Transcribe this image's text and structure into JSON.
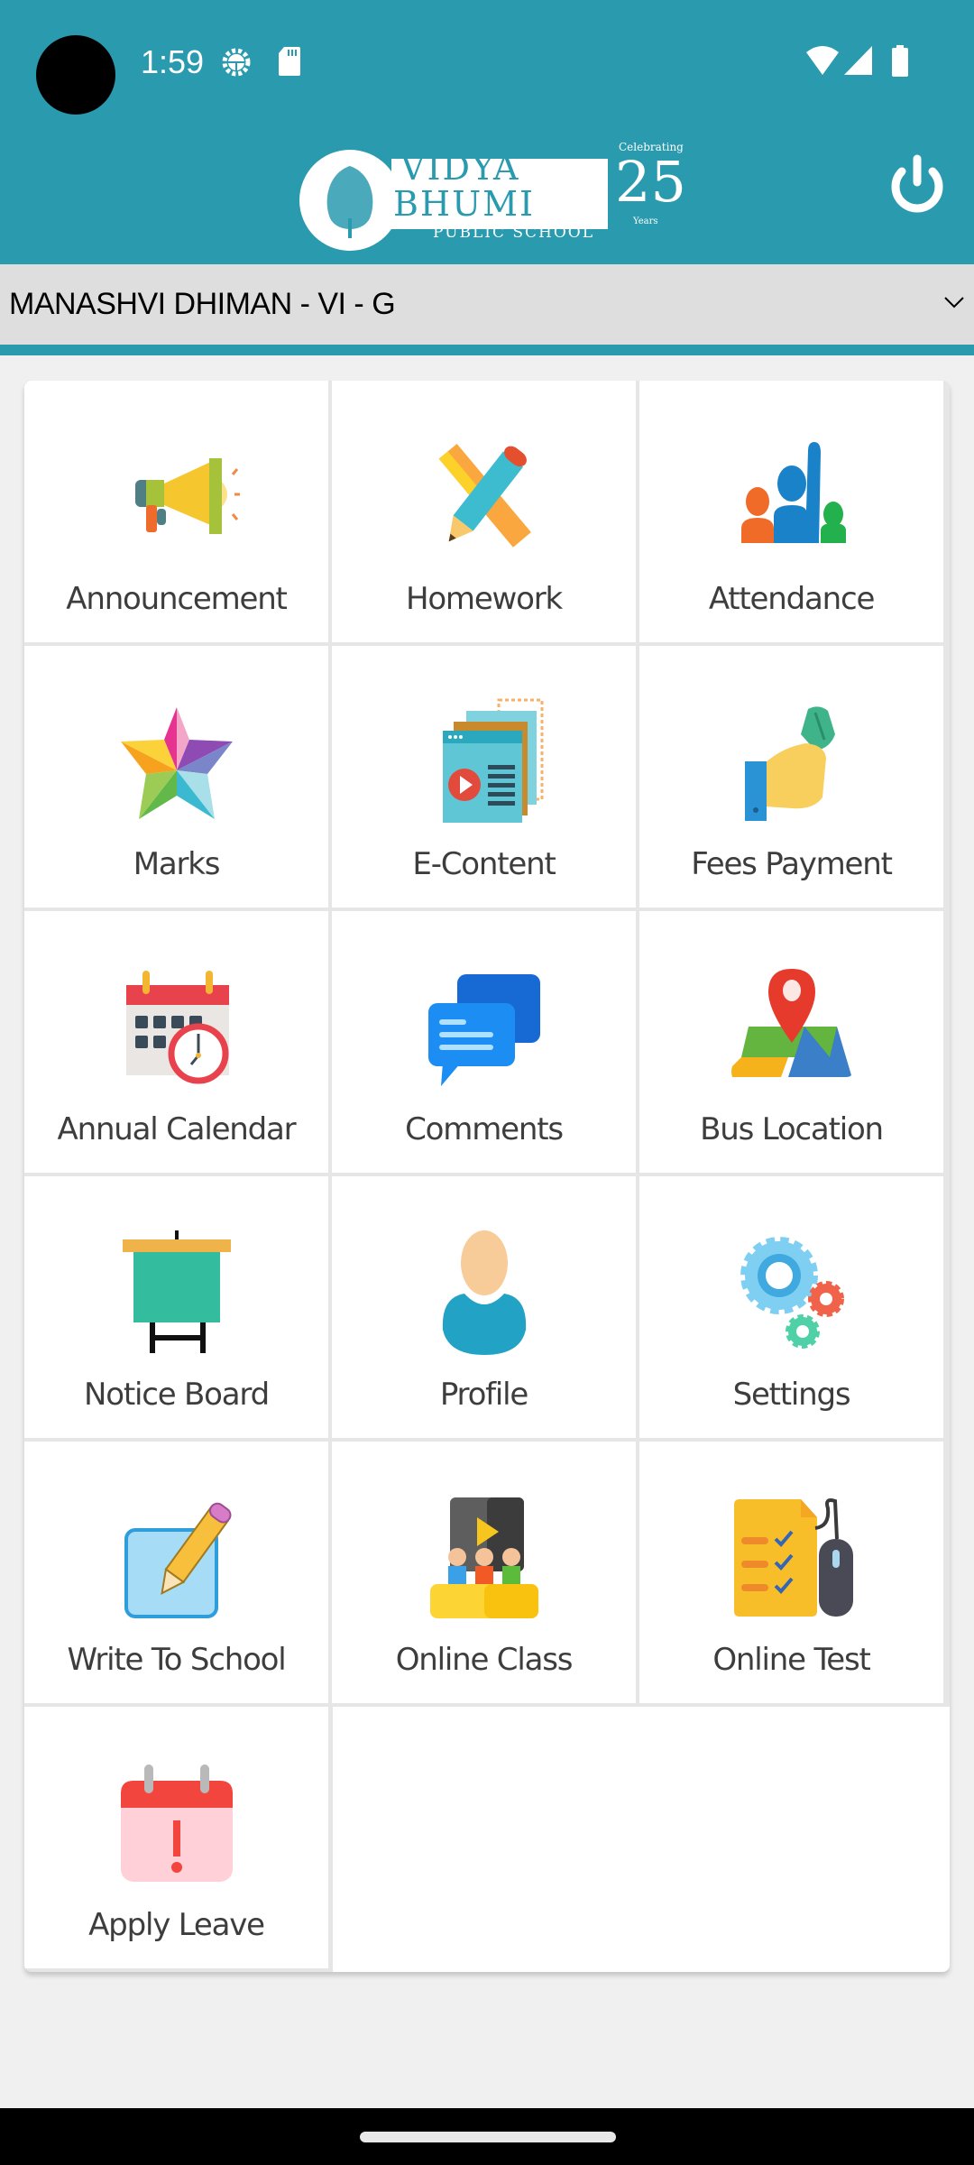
{
  "status_bar": {
    "time": "1:59",
    "icons": [
      "camera-cutout",
      "android-debug-icon",
      "sd-card-icon",
      "wifi-icon",
      "cellular-signal-icon",
      "battery-icon"
    ]
  },
  "header": {
    "logo": {
      "line1": "VIDYA",
      "line2": "BHUMI",
      "subtitle": "PUBLIC SCHOOL",
      "badge_number": "25",
      "badge_top": "Celebrating",
      "badge_bottom": "Years"
    },
    "power_icon": "power-icon",
    "colors": {
      "primary": "#2a9aae"
    }
  },
  "student_selector": {
    "selected": "MANASHVI DHIMAN - VI - G",
    "icon": "chevron-down-icon"
  },
  "menu": {
    "items": [
      {
        "label": "Announcement",
        "icon": "megaphone-icon"
      },
      {
        "label": "Homework",
        "icon": "pencil-ruler-icon"
      },
      {
        "label": "Attendance",
        "icon": "raised-hand-group-icon"
      },
      {
        "label": "Marks",
        "icon": "star-icon"
      },
      {
        "label": "E-Content",
        "icon": "video-document-icon"
      },
      {
        "label": "Fees Payment",
        "icon": "hand-money-icon"
      },
      {
        "label": "Annual Calendar",
        "icon": "calendar-clock-icon"
      },
      {
        "label": "Comments",
        "icon": "chat-bubbles-icon"
      },
      {
        "label": "Bus Location",
        "icon": "map-pin-icon"
      },
      {
        "label": "Notice Board",
        "icon": "notice-board-icon"
      },
      {
        "label": "Profile",
        "icon": "user-icon"
      },
      {
        "label": "Settings",
        "icon": "gears-icon"
      },
      {
        "label": "Write To School",
        "icon": "pencil-note-icon"
      },
      {
        "label": "Online Class",
        "icon": "online-class-icon"
      },
      {
        "label": "Online Test",
        "icon": "checklist-mouse-icon"
      },
      {
        "label": "Apply Leave",
        "icon": "calendar-alert-icon"
      }
    ]
  }
}
